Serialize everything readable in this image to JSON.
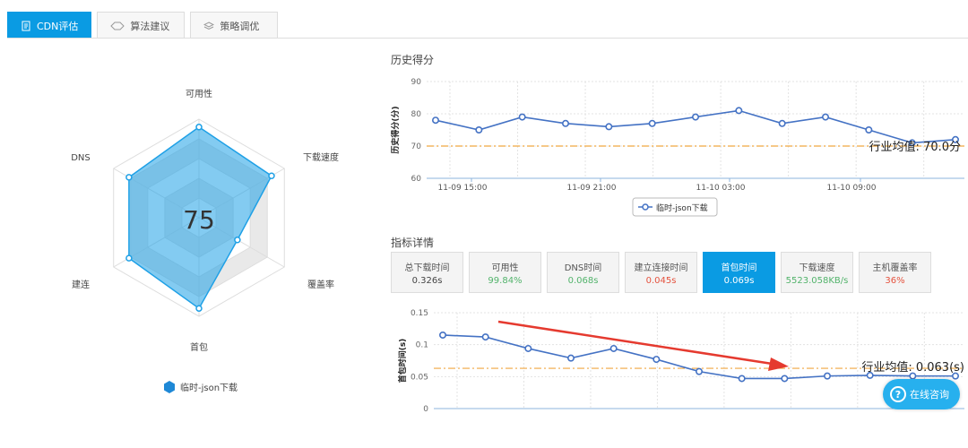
{
  "tabs": [
    {
      "label": "CDN评估",
      "icon": "document-icon",
      "active": true
    },
    {
      "label": "算法建议",
      "icon": "diamond-icon",
      "active": false
    },
    {
      "label": "策略调优",
      "icon": "layers-icon",
      "active": false
    }
  ],
  "radar": {
    "score": "75",
    "legend": "临时-json下载",
    "axes": [
      "可用性",
      "下载速度",
      "覆盖率",
      "首包",
      "建连",
      "DNS"
    ],
    "values": [
      0.92,
      0.85,
      0.45,
      0.92,
      0.82,
      0.82
    ],
    "color": "#1ea0e6"
  },
  "history": {
    "title": "历史得分",
    "legend": "临时-json下载",
    "industry_label": "行业均值: 70.0分"
  },
  "metrics": {
    "title": "指标详情",
    "industry_label": "行业均值: 0.063(s)",
    "cards": [
      {
        "label": "总下载时间",
        "value": "0.326s",
        "tone": "blue",
        "active": false
      },
      {
        "label": "可用性",
        "value": "99.84%",
        "tone": "green",
        "active": false
      },
      {
        "label": "DNS时间",
        "value": "0.068s",
        "tone": "green",
        "active": false
      },
      {
        "label": "建立连接时间",
        "value": "0.045s",
        "tone": "red",
        "active": false
      },
      {
        "label": "首包时间",
        "value": "0.069s",
        "tone": "blue",
        "active": true
      },
      {
        "label": "下载速度",
        "value": "5523.058KB/s",
        "tone": "green",
        "active": false
      },
      {
        "label": "主机覆盖率",
        "value": "36%",
        "tone": "red",
        "active": false
      }
    ]
  },
  "chat_button": {
    "label": "在线咨询",
    "icon": "question-icon"
  },
  "chart_data": [
    {
      "type": "line",
      "title": "",
      "ylabel": "历史得分(分)",
      "xlabel": "",
      "ylim": [
        60,
        90
      ],
      "yticks": [
        60,
        70,
        80,
        90
      ],
      "xtick_labels": [
        "11-09 15:00",
        "11-09 21:00",
        "11-10 03:00",
        "11-10 09:00"
      ],
      "reference_line": 70,
      "series": [
        {
          "name": "临时-json下载",
          "values": [
            78,
            75,
            79,
            77,
            76,
            77,
            79,
            81,
            77,
            79,
            75,
            71,
            72
          ]
        }
      ]
    },
    {
      "type": "line",
      "title": "",
      "ylabel": "首包时间(s)",
      "xlabel": "",
      "ylim": [
        0,
        0.15
      ],
      "yticks": [
        0,
        0.05,
        0.1,
        0.15
      ],
      "reference_line": 0.063,
      "values": [
        0.115,
        0.112,
        0.094,
        0.079,
        0.094,
        0.077,
        0.058,
        0.047,
        0.047,
        0.051,
        0.052,
        0.051,
        0.051
      ]
    }
  ]
}
